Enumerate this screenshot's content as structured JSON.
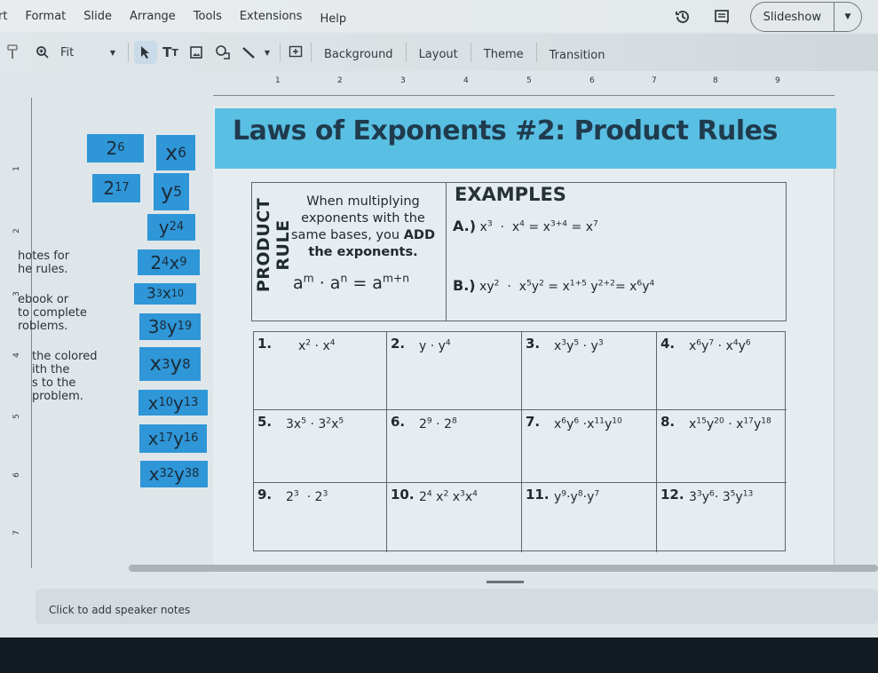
{
  "menubar": {
    "items": [
      "rt",
      "Format",
      "Slide",
      "Arrange",
      "Tools",
      "Extensions",
      "Help"
    ],
    "slideshow_label": "Slideshow"
  },
  "toolbar": {
    "zoom_value": "Fit",
    "background_label": "Background",
    "layout_label": "Layout",
    "theme_label": "Theme",
    "transition_label": "Transition"
  },
  "ruler": {
    "top": [
      "1",
      "2",
      "3",
      "4",
      "5",
      "6",
      "7",
      "8",
      "9"
    ],
    "left": [
      "1",
      "2",
      "3",
      "4",
      "5",
      "6",
      "7"
    ]
  },
  "left_notes": {
    "line1": "hotes for",
    "line2": "he rules.",
    "line3": "ebook or",
    "line4": "to complete",
    "line5": "roblems.",
    "line6": "the colored",
    "line7": "ith the",
    "line8": "s to the",
    "line9": "problem."
  },
  "tiles": [
    {
      "base": "2",
      "exp": "6"
    },
    {
      "base": "x",
      "exp": "6"
    },
    {
      "base": "2",
      "exp": "17"
    },
    {
      "base": "y",
      "exp": "5"
    },
    {
      "base": "y",
      "exp": "24"
    },
    {
      "html": "2<sup>4</sup>x<sup>9</sup>"
    },
    {
      "html": "3<sup>3</sup>x<sup>10</sup>"
    },
    {
      "html": "3<sup>8</sup>y<sup>19</sup>"
    },
    {
      "html": "x<sup>3</sup>y<sup>8</sup>"
    },
    {
      "html": "x<sup>10</sup>y<sup>13</sup>"
    },
    {
      "html": "x<sup>17</sup>y<sup>16</sup>"
    },
    {
      "html": "x<sup>32</sup>y<sup>38</sup>"
    }
  ],
  "slide": {
    "title": "Laws of Exponents #2: Product Rules",
    "rule_label": "PRODUCT RULE",
    "rule_text_1": "When multiplying exponents with the same bases, you ",
    "rule_text_bold_1": "ADD",
    "rule_text_bold_2": "the exponents.",
    "rule_formula": "a<sup>m</sup> · a<sup>n</sup> = a<sup>m+n</sup>",
    "examples_title": "EXAMPLES",
    "examples": [
      {
        "label": "A.)",
        "expr": "x<sup>3</sup> &nbsp;· &nbsp;x<sup>4</sup> = x<sup>3+4</sup> = x<sup>7</sup>"
      },
      {
        "label": "B.)",
        "expr": "xy<sup>2</sup> &nbsp;· &nbsp;x<sup>5</sup>y<sup>2</sup> = x<sup>1+5</sup> y<sup>2+2</sup>= x<sup>6</sup>y<sup>4</sup>"
      }
    ],
    "problems": [
      {
        "num": "1.",
        "expr": "x<sup>2</sup> · x<sup>4</sup>"
      },
      {
        "num": "2.",
        "expr": "y · y<sup>4</sup>"
      },
      {
        "num": "3.",
        "expr": "x<sup>3</sup>y<sup>5</sup> · y<sup>3</sup>"
      },
      {
        "num": "4.",
        "expr": "x<sup>6</sup>y<sup>7</sup> · x<sup>4</sup>y<sup>6</sup>"
      },
      {
        "num": "5.",
        "expr": "3x<sup>5</sup> · 3<sup>2</sup>x<sup>5</sup>"
      },
      {
        "num": "6.",
        "expr": "2<sup>9</sup> · 2<sup>8</sup>"
      },
      {
        "num": "7.",
        "expr": "x<sup>6</sup>y<sup>6</sup> ·x<sup>11</sup>y<sup>10</sup>"
      },
      {
        "num": "8.",
        "expr": "x<sup>15</sup>y<sup>20</sup> · x<sup>17</sup>y<sup>18</sup>"
      },
      {
        "num": "9.",
        "expr": "2<sup>3</sup> &nbsp;· 2<sup>3</sup>"
      },
      {
        "num": "10.",
        "expr": "2<sup>4</sup> x<sup>2</sup> x<sup>3</sup>x<sup>4</sup>"
      },
      {
        "num": "11.",
        "expr": "y<sup>9</sup>·y<sup>8</sup>·y<sup>7</sup>"
      },
      {
        "num": "12.",
        "expr": "3<sup>3</sup>y<sup>6</sup>· 3<sup>5</sup>y<sup>13</sup>"
      }
    ]
  },
  "speaker_notes_placeholder": "Click to add speaker notes"
}
